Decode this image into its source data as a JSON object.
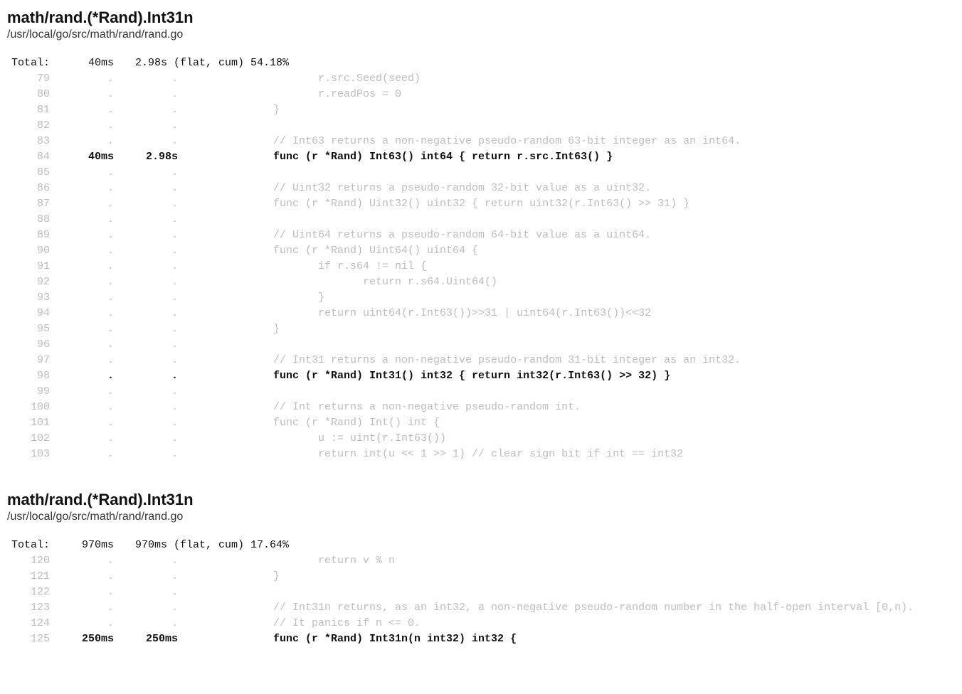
{
  "sections": [
    {
      "title": "math/rand.(*Rand).Int31n",
      "path": "/usr/local/go/src/math/rand/rand.go",
      "total": {
        "label": "Total:",
        "flat": "40ms",
        "cum": "2.98s (flat, cum) 54.18%"
      },
      "lines": [
        {
          "ln": "79",
          "flat": ".",
          "cum": ".",
          "code": "             r.src.Seed(seed)",
          "hot": false
        },
        {
          "ln": "80",
          "flat": ".",
          "cum": ".",
          "code": "             r.readPos = 0",
          "hot": false
        },
        {
          "ln": "81",
          "flat": ".",
          "cum": ".",
          "code": "      }",
          "hot": false
        },
        {
          "ln": "82",
          "flat": ".",
          "cum": ".",
          "code": "",
          "hot": false
        },
        {
          "ln": "83",
          "flat": ".",
          "cum": ".",
          "code": "      // Int63 returns a non-negative pseudo-random 63-bit integer as an int64.",
          "hot": false
        },
        {
          "ln": "84",
          "flat": "40ms",
          "cum": "2.98s",
          "code": "      func (r *Rand) Int63() int64 { return r.src.Int63() }",
          "hot": true
        },
        {
          "ln": "85",
          "flat": ".",
          "cum": ".",
          "code": "",
          "hot": false
        },
        {
          "ln": "86",
          "flat": ".",
          "cum": ".",
          "code": "      // Uint32 returns a pseudo-random 32-bit value as a uint32.",
          "hot": false
        },
        {
          "ln": "87",
          "flat": ".",
          "cum": ".",
          "code": "      func (r *Rand) Uint32() uint32 { return uint32(r.Int63() >> 31) }",
          "hot": false
        },
        {
          "ln": "88",
          "flat": ".",
          "cum": ".",
          "code": "",
          "hot": false
        },
        {
          "ln": "89",
          "flat": ".",
          "cum": ".",
          "code": "      // Uint64 returns a pseudo-random 64-bit value as a uint64.",
          "hot": false
        },
        {
          "ln": "90",
          "flat": ".",
          "cum": ".",
          "code": "      func (r *Rand) Uint64() uint64 {",
          "hot": false
        },
        {
          "ln": "91",
          "flat": ".",
          "cum": ".",
          "code": "             if r.s64 != nil {",
          "hot": false
        },
        {
          "ln": "92",
          "flat": ".",
          "cum": ".",
          "code": "                    return r.s64.Uint64()",
          "hot": false
        },
        {
          "ln": "93",
          "flat": ".",
          "cum": ".",
          "code": "             }",
          "hot": false
        },
        {
          "ln": "94",
          "flat": ".",
          "cum": ".",
          "code": "             return uint64(r.Int63())>>31 | uint64(r.Int63())<<32",
          "hot": false
        },
        {
          "ln": "95",
          "flat": ".",
          "cum": ".",
          "code": "      }",
          "hot": false
        },
        {
          "ln": "96",
          "flat": ".",
          "cum": ".",
          "code": "",
          "hot": false
        },
        {
          "ln": "97",
          "flat": ".",
          "cum": ".",
          "code": "      // Int31 returns a non-negative pseudo-random 31-bit integer as an int32.",
          "hot": false
        },
        {
          "ln": "98",
          "flat": ".",
          "cum": ".",
          "code": "      func (r *Rand) Int31() int32 { return int32(r.Int63() >> 32) }",
          "hot": true
        },
        {
          "ln": "99",
          "flat": ".",
          "cum": ".",
          "code": "",
          "hot": false
        },
        {
          "ln": "100",
          "flat": ".",
          "cum": ".",
          "code": "      // Int returns a non-negative pseudo-random int.",
          "hot": false
        },
        {
          "ln": "101",
          "flat": ".",
          "cum": ".",
          "code": "      func (r *Rand) Int() int {",
          "hot": false
        },
        {
          "ln": "102",
          "flat": ".",
          "cum": ".",
          "code": "             u := uint(r.Int63())",
          "hot": false
        },
        {
          "ln": "103",
          "flat": ".",
          "cum": ".",
          "code": "             return int(u << 1 >> 1) // clear sign bit if int == int32",
          "hot": false
        }
      ]
    },
    {
      "title": "math/rand.(*Rand).Int31n",
      "path": "/usr/local/go/src/math/rand/rand.go",
      "total": {
        "label": "Total:",
        "flat": "970ms",
        "cum": "970ms (flat, cum) 17.64%"
      },
      "lines": [
        {
          "ln": "120",
          "flat": ".",
          "cum": ".",
          "code": "             return v % n",
          "hot": false
        },
        {
          "ln": "121",
          "flat": ".",
          "cum": ".",
          "code": "      }",
          "hot": false
        },
        {
          "ln": "122",
          "flat": ".",
          "cum": ".",
          "code": "",
          "hot": false
        },
        {
          "ln": "123",
          "flat": ".",
          "cum": ".",
          "code": "      // Int31n returns, as an int32, a non-negative pseudo-random number in the half-open interval [0,n).",
          "hot": false
        },
        {
          "ln": "124",
          "flat": ".",
          "cum": ".",
          "code": "      // It panics if n <= 0.",
          "hot": false
        },
        {
          "ln": "125",
          "flat": "250ms",
          "cum": "250ms",
          "code": "      func (r *Rand) Int31n(n int32) int32 {",
          "hot": true
        }
      ]
    }
  ]
}
